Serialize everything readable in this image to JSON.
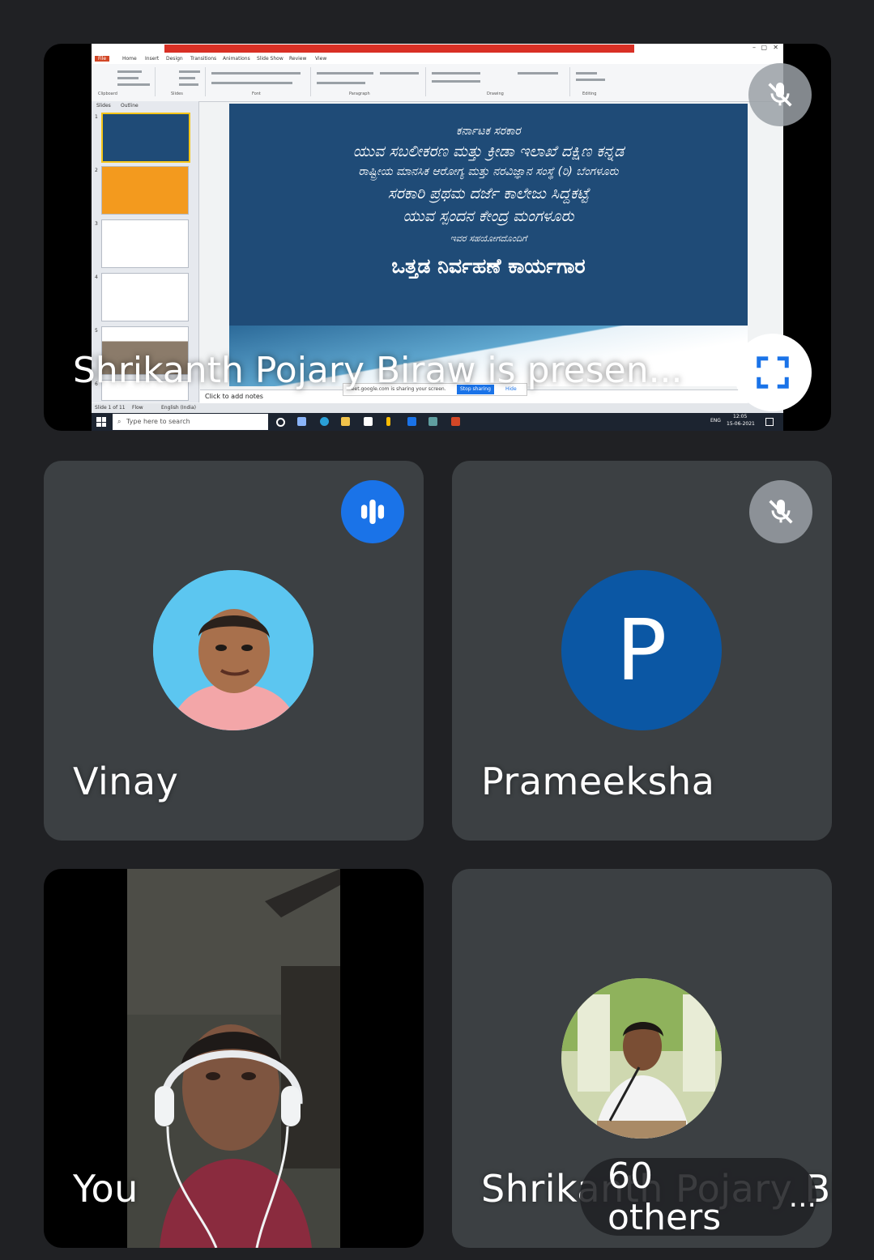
{
  "presentation": {
    "label": "Shrikanth Pojary Biraw is presen...",
    "window_title": "",
    "ribbon_tabs": [
      "File",
      "Home",
      "Insert",
      "Design",
      "Transitions",
      "Animations",
      "Slide Show",
      "Review",
      "View"
    ],
    "ribbon_groups": [
      "Clipboard",
      "Slides",
      "Font",
      "Paragraph",
      "Drawing",
      "Editing"
    ],
    "slides_tabs": [
      "Slides",
      "Outline"
    ],
    "thumb_numbers": [
      "1",
      "2",
      "3",
      "4",
      "5",
      "6"
    ],
    "notes_placeholder": "Click to add notes",
    "share_bar_text": "meet.google.com is sharing your screen.",
    "stop_sharing": "Stop sharing",
    "hide": "Hide",
    "status_left": "Slide 1 of 11",
    "status_theme": "Flow",
    "status_language": "English (India)",
    "taskbar_search": "Type here to search",
    "taskbar_lang": "ENG",
    "taskbar_time": "12:05",
    "taskbar_date": "15-06-2021",
    "slide_lines": [
      "ಕರ್ನಾಟಕ ಸರಕಾರ",
      "ಯುವ ಸಬಲೀಕರಣ ಮತ್ತು ಕ್ರೀಡಾ ಇಲಾಖೆ ದಕ್ಷಿಣ ಕನ್ನಡ",
      "ರಾಷ್ಟ್ರೀಯ ಮಾನಸಿಕ ಆರೋಗ್ಯ ಮತ್ತು ನರವಿಜ್ಞಾನ ಸಂಸ್ಥೆ (ರಿ) ಬೆಂಗಳೂರು",
      "ಸರಕಾರಿ ಪ್ರಥಮ ದರ್ಜೆ ಕಾಲೇಜು ಸಿದ್ದಕಟ್ಟೆ",
      "ಯುವ ಸ್ಪಂದನ ಕೇಂದ್ರ ಮಂಗಳೂರು",
      "ಇವರ ಸಹಯೋಗದೊಂದಿಗೆ",
      "ಒತ್ತಡ ನಿರ್ವಹಣೆ ಕಾರ್ಯಗಾರ"
    ]
  },
  "participants": {
    "vinay": {
      "name": "Vinay"
    },
    "prameeksha": {
      "name": "Prameeksha",
      "initial": "P",
      "avatar_color": "#0b57a4"
    },
    "you": {
      "name": "You"
    },
    "shrikanth": {
      "name": "Shrikanth Pojary Biraw"
    }
  },
  "others_pill": {
    "label": "60 others",
    "more": "..."
  },
  "colors": {
    "background": "#202124",
    "tile": "#3c4043",
    "speaking": "#1a73e8"
  }
}
